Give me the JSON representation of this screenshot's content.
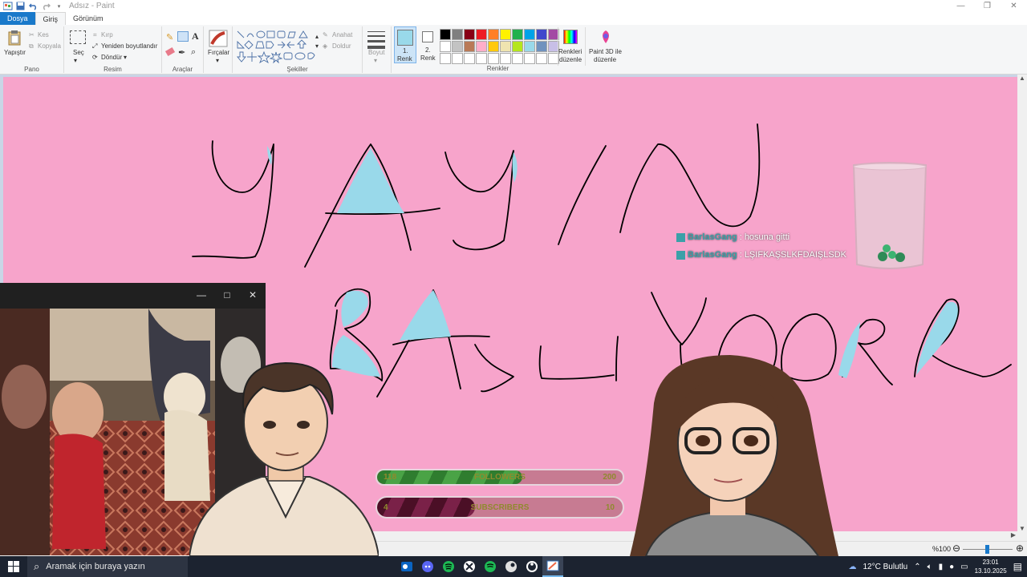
{
  "window": {
    "title": "Adsız - Paint",
    "controls": {
      "minimize": "—",
      "maximize": "❐",
      "close": "✕"
    }
  },
  "ribbon_tabs": [
    "Dosya",
    "Giriş",
    "Görünüm"
  ],
  "ribbon": {
    "pano": {
      "label": "Pano",
      "paste": "Yapıştır",
      "cut": "Kes",
      "copy": "Kopyala"
    },
    "resim": {
      "label": "Resim",
      "select": "Seç",
      "crop": "Kırp",
      "resize": "Yeniden boyutlandır",
      "rotate": "Döndür"
    },
    "araclar": {
      "label": "Araçlar"
    },
    "brushes": {
      "label": "Fırçalar"
    },
    "sekiller": {
      "label": "Şekiller",
      "outline": "Anahat",
      "fill": "Doldur"
    },
    "size": {
      "label": "Boyut"
    },
    "color1": {
      "label": "1.\nRenk",
      "line1": "1.",
      "line2": "Renk"
    },
    "color2": {
      "line1": "2.",
      "line2": "Renk"
    },
    "renkler": {
      "label": "Renkler"
    },
    "edit_colors": {
      "line1": "Renkleri",
      "line2": "düzenle"
    },
    "paint3d": {
      "line1": "Paint 3D ile",
      "line2": "düzenle"
    },
    "palette_row1": [
      "#000000",
      "#7f7f7f",
      "#880015",
      "#ed1c24",
      "#ff7f27",
      "#fff200",
      "#22b14c",
      "#00a2e8",
      "#3f48cc",
      "#a349a4"
    ],
    "palette_row2": [
      "#ffffff",
      "#c3c3c3",
      "#b97a57",
      "#ffaec9",
      "#ffc90e",
      "#efe4b0",
      "#b5e61d",
      "#99d9ea",
      "#7092be",
      "#c8bfe7"
    ],
    "palette_row3": [
      "#ffffff",
      "#ffffff",
      "#ffffff",
      "#ffffff",
      "#ffffff",
      "#ffffff",
      "#ffffff",
      "#ffffff",
      "#ffffff",
      "#ffffff"
    ]
  },
  "canvas": {
    "background": "#f7a4cb",
    "ink": "#000000",
    "fill_color": "#99d9ea"
  },
  "chat": [
    {
      "user": "BarlasGang",
      "sep": ":",
      "message": "hosuna gitti"
    },
    {
      "user": "BarlasGang",
      "sep": ":",
      "message": "LŞIFKAŞSLKFDAIŞLSDK"
    }
  ],
  "followers": {
    "current": "118",
    "label": "FOLLOWERS",
    "goal": "200",
    "progress": 0.59
  },
  "subscribers": {
    "current": "4",
    "label": "SUBSCRIBERS",
    "goal": "10",
    "progress": 0.4
  },
  "statusbar": {
    "zoom": "%100"
  },
  "taskbar": {
    "search_placeholder": "Aramak için buraya yazın",
    "weather": "12°C Bulutlu",
    "time": "23:01",
    "date": "13.10.2025"
  }
}
